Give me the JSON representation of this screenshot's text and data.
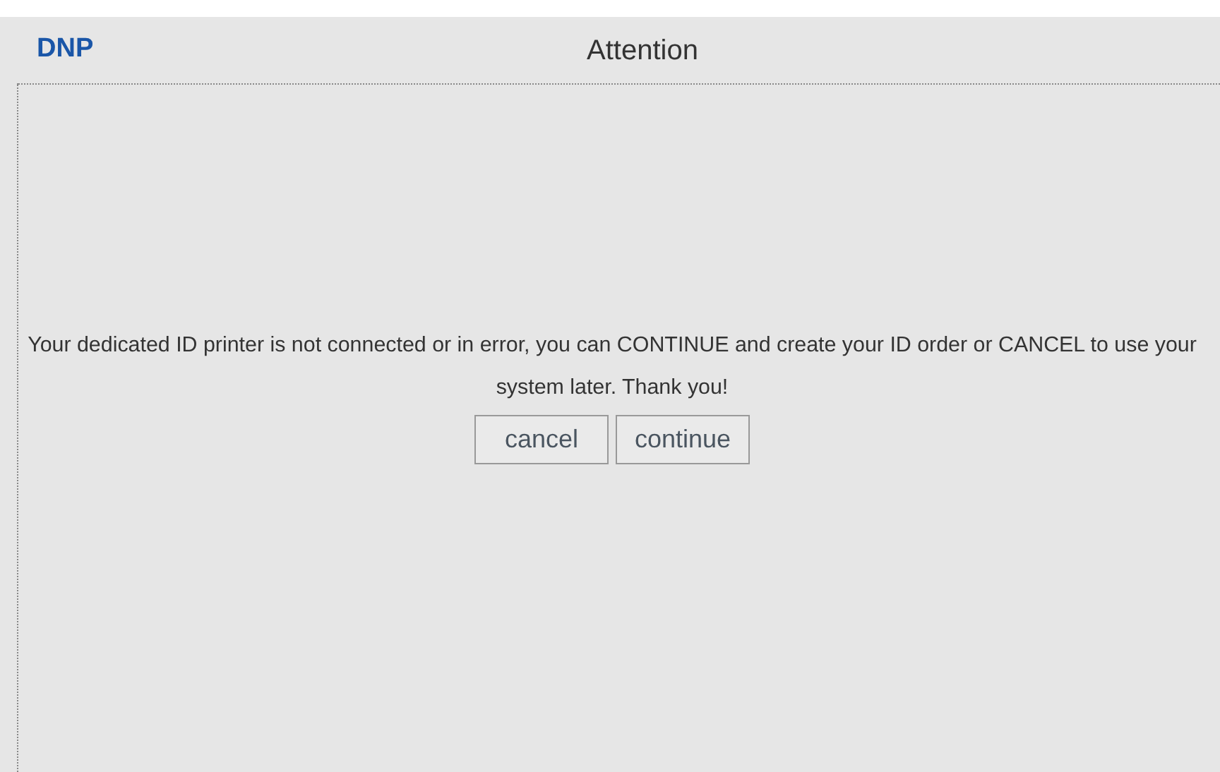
{
  "logo": "DNP",
  "title": "Attention",
  "message": "Your dedicated ID printer is not connected or in error, you can CONTINUE and create your ID order or CANCEL to use your system later. Thank you!",
  "buttons": [
    "cancel",
    "continue"
  ]
}
